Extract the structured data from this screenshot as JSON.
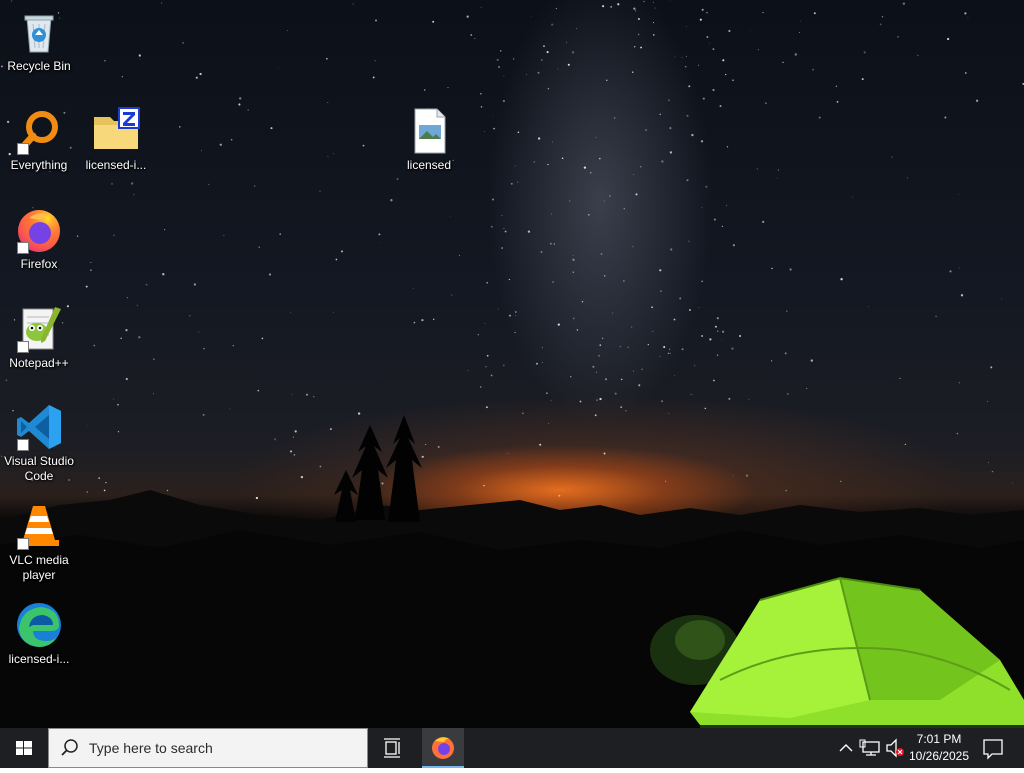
{
  "desktop": {
    "icons": [
      {
        "label": "Recycle Bin",
        "icon": "recycle-bin-icon",
        "shortcut": false
      },
      {
        "label": "Everything",
        "icon": "everything-search-icon",
        "shortcut": true
      },
      {
        "label": "licensed-i...",
        "icon": "zip-folder-icon",
        "shortcut": false
      },
      {
        "label": "licensed",
        "icon": "image-file-icon",
        "shortcut": false
      },
      {
        "label": "Firefox",
        "icon": "firefox-icon",
        "shortcut": true
      },
      {
        "label": "Notepad++",
        "icon": "notepad-plus-plus-icon",
        "shortcut": true
      },
      {
        "label": "Visual Studio Code",
        "icon": "vscode-icon",
        "shortcut": true
      },
      {
        "label": "VLC media player",
        "icon": "vlc-icon",
        "shortcut": true
      },
      {
        "label": "licensed-i...",
        "icon": "edge-icon",
        "shortcut": false
      }
    ]
  },
  "taskbar": {
    "search_placeholder": "Type here to search",
    "pinned": [
      {
        "icon": "firefox-icon",
        "active": true
      }
    ],
    "tray": {
      "icons": [
        "chevron-up-icon",
        "network-icon",
        "volume-muted-icon",
        "notification-icon"
      ]
    },
    "clock": {
      "time": "7:01 PM",
      "date": "10/26/2025"
    }
  },
  "colors": {
    "taskbar": "#1e1f22",
    "search_box": "#f3f3f3",
    "active_indicator": "#76b9ed",
    "tent_green": "#8ee02a"
  }
}
